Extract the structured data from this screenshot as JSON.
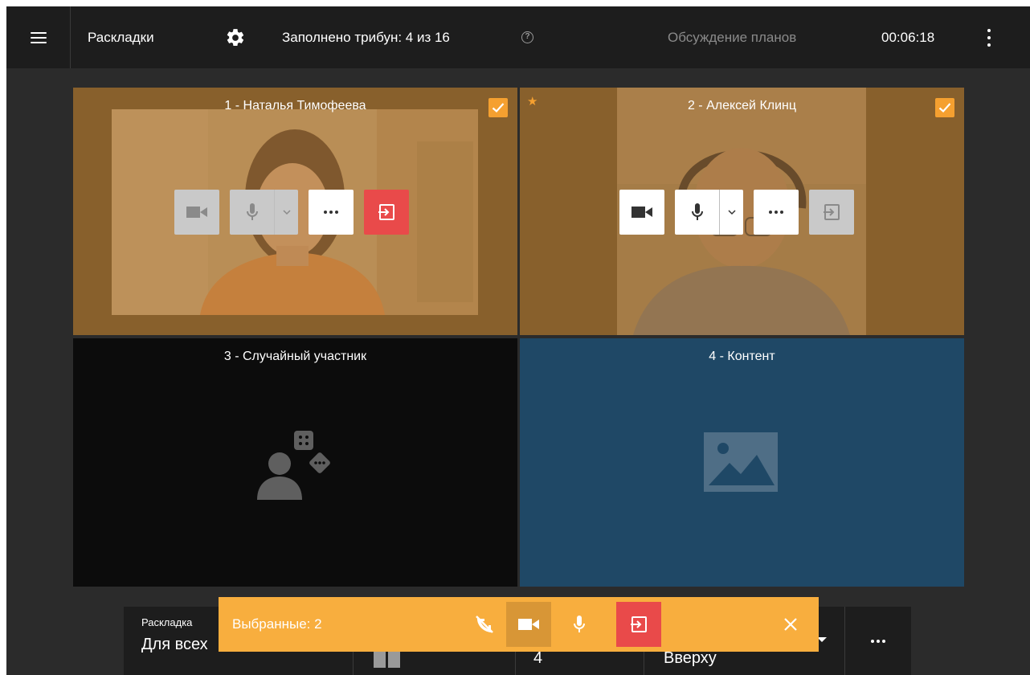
{
  "topbar": {
    "layouts_label": "Раскладки",
    "tribunes_label": "Заполнено трибун: 4 из 16",
    "help_icon": "?",
    "topic": "Обсуждение планов",
    "timer": "00:06:18"
  },
  "tiles": [
    {
      "title": "1 - Наталья Тимофеева",
      "selected": true
    },
    {
      "title": "2 - Алексей Клинц",
      "selected": true,
      "starred": true
    },
    {
      "title": "3 - Случайный участник"
    },
    {
      "title": "4 - Контент"
    }
  ],
  "bottom_panel": {
    "layout_label": "Раскладка",
    "layout_value": "Для всех",
    "count_value": "4",
    "position_value": "Вверху"
  },
  "selection_bar": {
    "label": "Выбранные: 2"
  },
  "colors": {
    "accent": "#f8ae3e",
    "danger": "#e94a4a",
    "topbar": "#1d1d1d",
    "content_tile": "#1f4866"
  },
  "icons": [
    "menu-icon",
    "gear-icon",
    "help-icon",
    "kebab-icon",
    "camera-icon",
    "microphone-icon",
    "chevron-down-icon",
    "more-icon",
    "leave-icon",
    "checkbox-icon",
    "star-icon",
    "random-participant-icon",
    "image-icon",
    "mute-all-icon",
    "close-icon"
  ]
}
